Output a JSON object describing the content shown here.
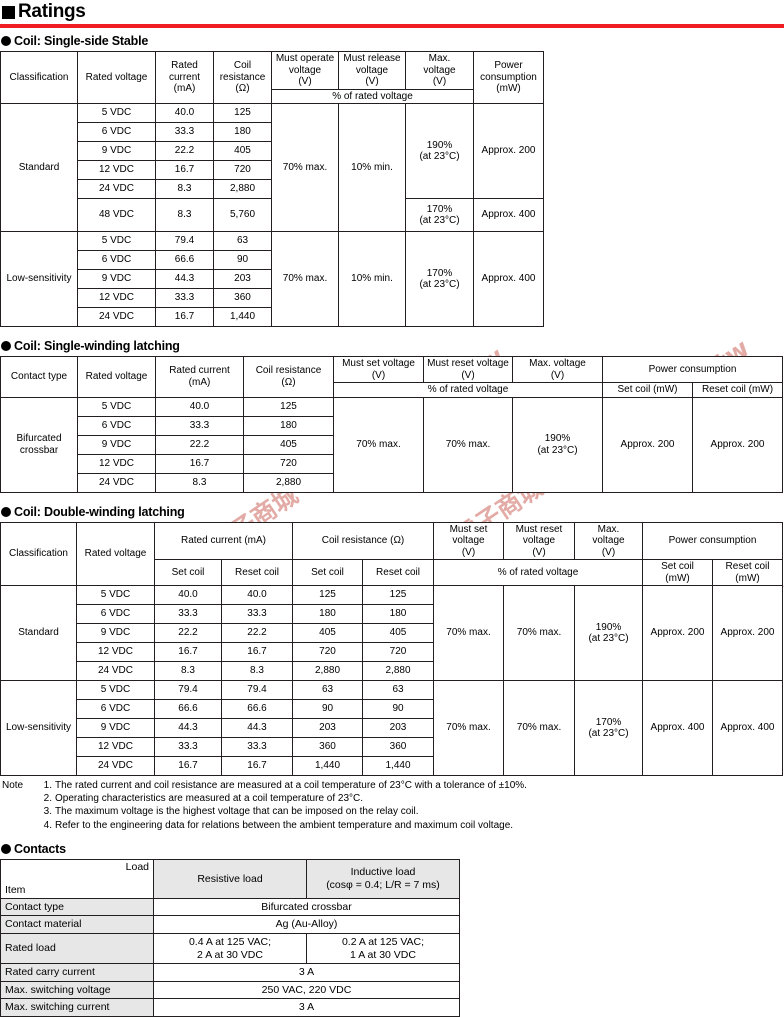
{
  "page": {
    "title": "Ratings",
    "accent_color": "#ef1c21",
    "header_bg": "#e7e7e7",
    "watermark": {
      "line1": "廣華電子商城 shop.cpu.com.tw",
      "line2": "廣華電子商城 shop.cpu.com.tw",
      "line3": "廣華電子商城 shop.cpu.com.tw",
      "color": "#d98c84"
    }
  },
  "single_side": {
    "heading": "Coil: Single-side Stable",
    "headers": {
      "classification": "Classification",
      "rated_voltage": "Rated voltage",
      "rated_current": "Rated\ncurrent\n(mA)",
      "rated_current_l1": "Rated",
      "rated_current_l2": "current",
      "rated_current_l3": "(mA)",
      "coil_resistance_l1": "Coil",
      "coil_resistance_l2": "resistance",
      "coil_resistance_l3": "(Ω)",
      "must_operate_l1": "Must operate",
      "must_operate_l2": "voltage",
      "must_operate_l3": "(V)",
      "must_release_l1": "Must release",
      "must_release_l2": "voltage",
      "must_release_l3": "(V)",
      "max_voltage_l1": "Max.",
      "max_voltage_l2": "voltage",
      "max_voltage_l3": "(V)",
      "power_l1": "Power",
      "power_l2": "consumption",
      "power_l3": "(mW)",
      "pct_of_rated": "% of rated voltage"
    },
    "groups": [
      {
        "name": "Standard",
        "must_operate": "70% max.",
        "must_release": "10% min.",
        "rows": [
          {
            "voltage": "5 VDC",
            "current": "40.0",
            "resistance": "125"
          },
          {
            "voltage": "6 VDC",
            "current": "33.3",
            "resistance": "180"
          },
          {
            "voltage": "9 VDC",
            "current": "22.2",
            "resistance": "405"
          },
          {
            "voltage": "12 VDC",
            "current": "16.7",
            "resistance": "720"
          },
          {
            "voltage": "24 VDC",
            "current": "8.3",
            "resistance": "2,880"
          },
          {
            "voltage": "48 VDC",
            "current": "8.3",
            "resistance": "5,760"
          }
        ],
        "max_voltage_1_l1": "190%",
        "max_voltage_1_l2": "(at 23°C)",
        "power_1": "Approx. 200",
        "max_voltage_2_l1": "170%",
        "max_voltage_2_l2": "(at 23°C)",
        "power_2": "Approx. 400"
      },
      {
        "name": "Low-sensitivity",
        "must_operate": "70% max.",
        "must_release": "10% min.",
        "rows": [
          {
            "voltage": "5 VDC",
            "current": "79.4",
            "resistance": "63"
          },
          {
            "voltage": "6 VDC",
            "current": "66.6",
            "resistance": "90"
          },
          {
            "voltage": "9 VDC",
            "current": "44.3",
            "resistance": "203"
          },
          {
            "voltage": "12 VDC",
            "current": "33.3",
            "resistance": "360"
          },
          {
            "voltage": "24 VDC",
            "current": "16.7",
            "resistance": "1,440"
          }
        ],
        "max_voltage_1_l1": "170%",
        "max_voltage_1_l2": "(at 23°C)",
        "power_1": "Approx. 400"
      }
    ]
  },
  "single_winding": {
    "heading": "Coil: Single-winding latching",
    "headers": {
      "contact_type": "Contact type",
      "rated_voltage": "Rated voltage",
      "rated_current_l1": "Rated current",
      "rated_current_l2": "(mA)",
      "coil_resistance_l1": "Coil resistance",
      "coil_resistance_l2": "(Ω)",
      "must_set_l1": "Must set voltage",
      "must_set_l2": "(V)",
      "must_reset_l1": "Must reset voltage",
      "must_reset_l2": "(V)",
      "max_voltage_l1": "Max. voltage",
      "max_voltage_l2": "(V)",
      "power_consumption": "Power consumption",
      "pct_of_rated": "% of rated voltage",
      "set_coil_mw": "Set coil (mW)",
      "reset_coil_mw": "Reset coil (mW)"
    },
    "contact_type_value_l1": "Bifurcated",
    "contact_type_value_l2": "crossbar",
    "rows": [
      {
        "voltage": "5 VDC",
        "current": "40.0",
        "resistance": "125"
      },
      {
        "voltage": "6 VDC",
        "current": "33.3",
        "resistance": "180"
      },
      {
        "voltage": "9 VDC",
        "current": "22.2",
        "resistance": "405"
      },
      {
        "voltage": "12 VDC",
        "current": "16.7",
        "resistance": "720"
      },
      {
        "voltage": "24 VDC",
        "current": "8.3",
        "resistance": "2,880"
      }
    ],
    "must_set": "70% max.",
    "must_reset": "70% max.",
    "max_voltage_l1": "190%",
    "max_voltage_l2": "(at 23°C)",
    "set_coil_power": "Approx. 200",
    "reset_coil_power": "Approx. 200"
  },
  "double_winding": {
    "heading": "Coil: Double-winding latching",
    "headers": {
      "classification": "Classification",
      "rated_voltage": "Rated voltage",
      "rated_current": "Rated current (mA)",
      "coil_resistance": "Coil resistance (Ω)",
      "set_coil": "Set coil",
      "reset_coil": "Reset coil",
      "must_set_l1": "Must set",
      "must_set_l2": "voltage",
      "must_set_l3": "(V)",
      "must_reset_l1": "Must reset",
      "must_reset_l2": "voltage",
      "must_reset_l3": "(V)",
      "max_voltage_l1": "Max.",
      "max_voltage_l2": "voltage",
      "max_voltage_l3": "(V)",
      "power_consumption": "Power consumption",
      "pct_of_rated": "% of rated voltage",
      "set_coil_mw_l1": "Set coil",
      "set_coil_mw_l2": "(mW)",
      "reset_coil_mw_l1": "Reset coil",
      "reset_coil_mw_l2": "(mW)"
    },
    "groups": [
      {
        "name": "Standard",
        "rows": [
          {
            "voltage": "5 VDC",
            "set_current": "40.0",
            "reset_current": "40.0",
            "set_res": "125",
            "reset_res": "125"
          },
          {
            "voltage": "6 VDC",
            "set_current": "33.3",
            "reset_current": "33.3",
            "set_res": "180",
            "reset_res": "180"
          },
          {
            "voltage": "9 VDC",
            "set_current": "22.2",
            "reset_current": "22.2",
            "set_res": "405",
            "reset_res": "405"
          },
          {
            "voltage": "12 VDC",
            "set_current": "16.7",
            "reset_current": "16.7",
            "set_res": "720",
            "reset_res": "720"
          },
          {
            "voltage": "24 VDC",
            "set_current": "8.3",
            "reset_current": "8.3",
            "set_res": "2,880",
            "reset_res": "2,880"
          }
        ],
        "must_set": "70% max.",
        "must_reset": "70% max.",
        "max_voltage_l1": "190%",
        "max_voltage_l2": "(at 23°C)",
        "set_power": "Approx. 200",
        "reset_power": "Approx. 200"
      },
      {
        "name": "Low-sensitivity",
        "rows": [
          {
            "voltage": "5 VDC",
            "set_current": "79.4",
            "reset_current": "79.4",
            "set_res": "63",
            "reset_res": "63"
          },
          {
            "voltage": "6 VDC",
            "set_current": "66.6",
            "reset_current": "66.6",
            "set_res": "90",
            "reset_res": "90"
          },
          {
            "voltage": "9 VDC",
            "set_current": "44.3",
            "reset_current": "44.3",
            "set_res": "203",
            "reset_res": "203"
          },
          {
            "voltage": "12 VDC",
            "set_current": "33.3",
            "reset_current": "33.3",
            "set_res": "360",
            "reset_res": "360"
          },
          {
            "voltage": "24 VDC",
            "set_current": "16.7",
            "reset_current": "16.7",
            "set_res": "1,440",
            "reset_res": "1,440"
          }
        ],
        "must_set": "70% max.",
        "must_reset": "70% max.",
        "max_voltage_l1": "170%",
        "max_voltage_l2": "(at 23°C)",
        "set_power": "Approx. 400",
        "reset_power": "Approx. 400"
      }
    ]
  },
  "notes": {
    "lead": "Note",
    "items": [
      {
        "num": "1.",
        "text": "The rated current and coil resistance are measured at a coil temperature of 23°C with a tolerance of ±10%."
      },
      {
        "num": "2.",
        "text": "Operating characteristics are measured at a coil temperature of 23°C."
      },
      {
        "num": "3.",
        "text": "The maximum voltage is the highest voltage that can be imposed on the relay coil."
      },
      {
        "num": "4.",
        "text": "Refer to the engineering data for relations between the ambient temperature and maximum coil voltage."
      }
    ]
  },
  "contacts": {
    "heading": "Contacts",
    "headers": {
      "load": "Load",
      "item": "Item",
      "resistive": "Resistive load",
      "inductive_l1": "Inductive load",
      "inductive_l2": "(cosφ = 0.4; L/R = 7 ms)"
    },
    "rows": [
      {
        "item": "Contact type",
        "span": true,
        "value": "Bifurcated crossbar"
      },
      {
        "item": "Contact material",
        "span": true,
        "value": "Ag (Au-Alloy)"
      },
      {
        "item": "Rated load",
        "span": false,
        "resistive_l1": "0.4 A at 125 VAC;",
        "resistive_l2": "2 A at 30 VDC",
        "inductive_l1": "0.2 A at 125 VAC;",
        "inductive_l2": "1 A at 30 VDC"
      },
      {
        "item": "Rated carry current",
        "span": true,
        "value": "3 A"
      },
      {
        "item": "Max. switching voltage",
        "span": true,
        "value": "250 VAC, 220 VDC"
      },
      {
        "item": "Max. switching current",
        "span": true,
        "value": "3 A"
      }
    ]
  }
}
